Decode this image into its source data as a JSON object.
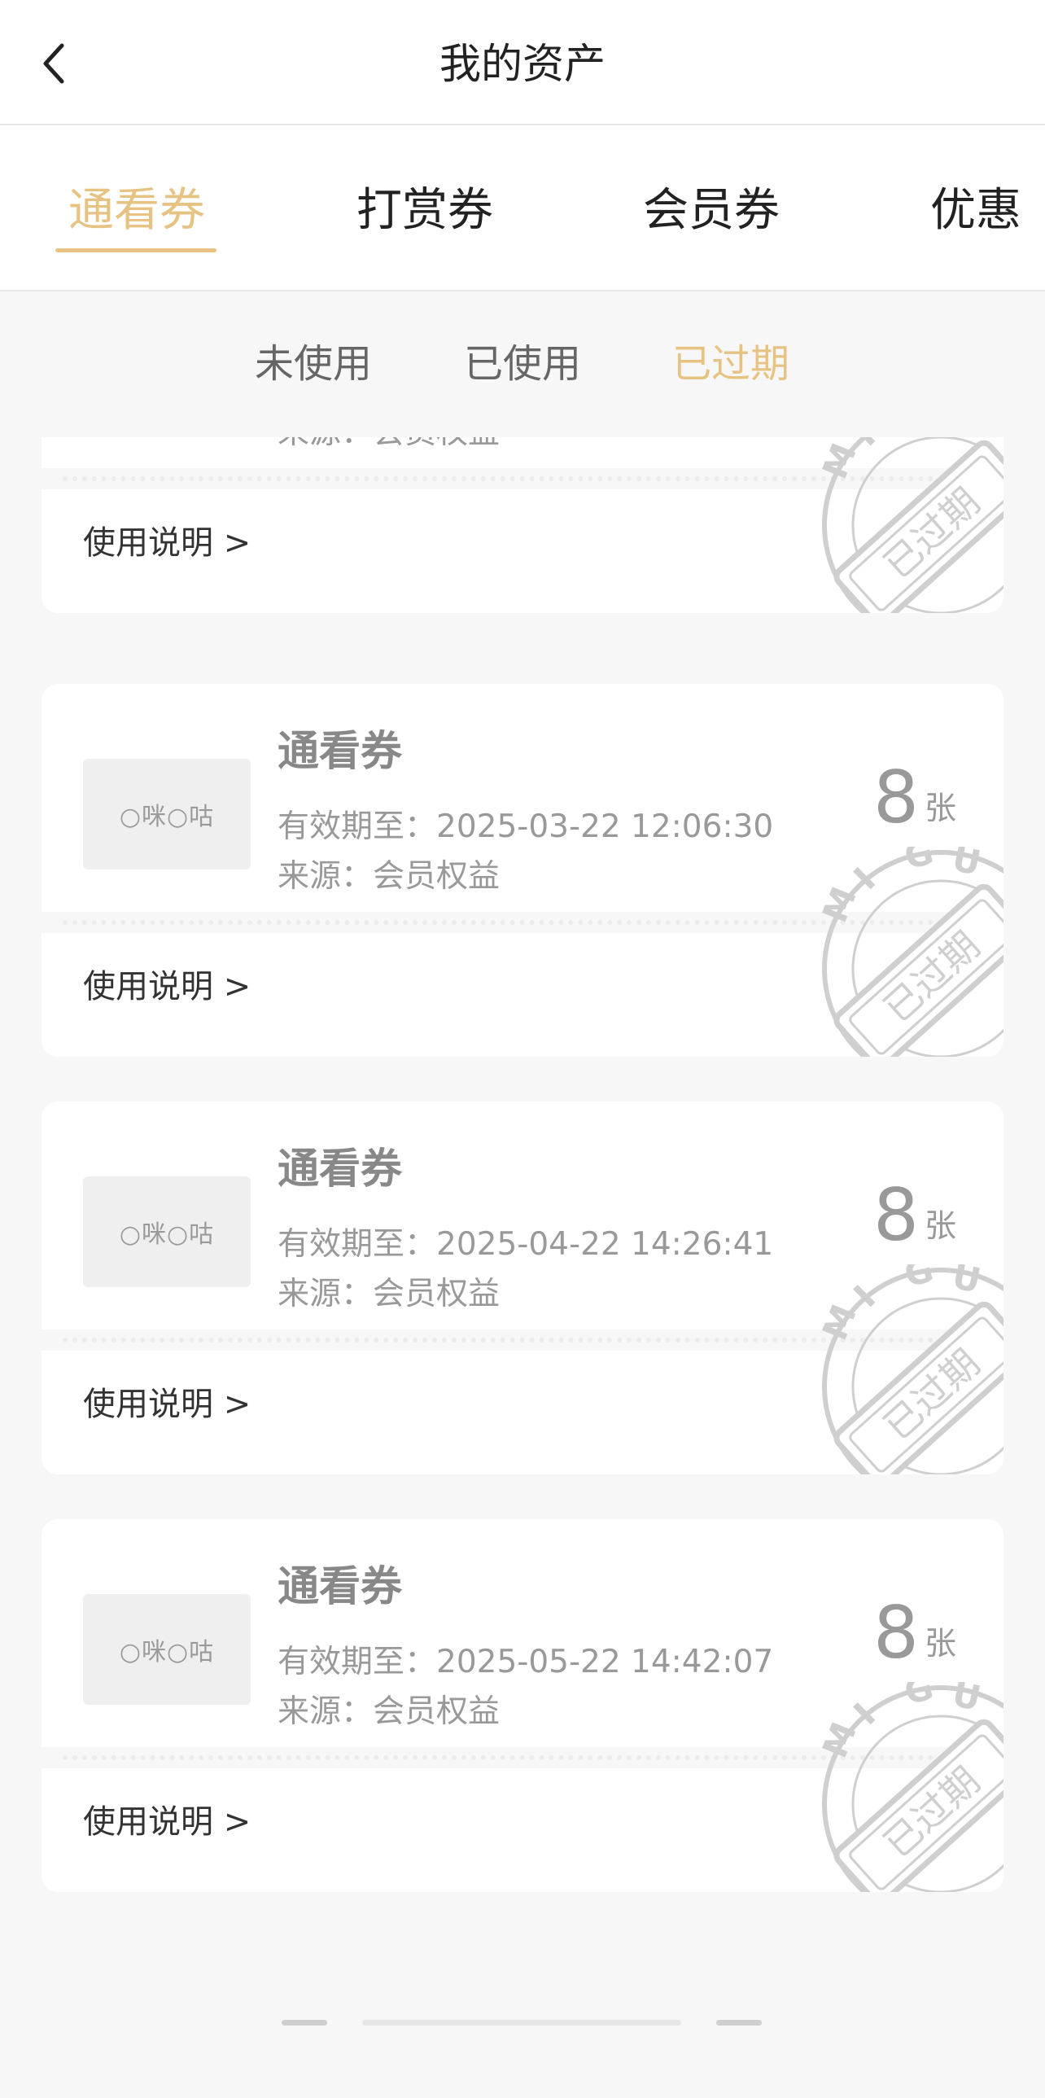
{
  "header": {
    "title": "我的资产",
    "back_icon": "chevron-left-icon"
  },
  "tabs": [
    {
      "label": "通看券",
      "active": true
    },
    {
      "label": "打赏券",
      "active": false
    },
    {
      "label": "会员券",
      "active": false
    },
    {
      "label": "优惠",
      "active": false
    }
  ],
  "subtabs": [
    {
      "label": "未使用",
      "active": false
    },
    {
      "label": "已使用",
      "active": false
    },
    {
      "label": "已过期",
      "active": true
    }
  ],
  "colors": {
    "accent": "#e7c383",
    "background": "#f7f7f7",
    "card": "#ffffff",
    "muted_text": "#999999",
    "stamp": "#cccccc"
  },
  "cards": [
    {
      "title": "",
      "expiry": "",
      "source": "来源：会员权益",
      "count": "",
      "unit": "",
      "instructions": "使用说明 >",
      "thumb_text": "",
      "stamp": {
        "letters": [
          "M",
          "I",
          "G",
          "U"
        ],
        "label": "已过期"
      }
    },
    {
      "title": "通看券",
      "expiry": "有效期至：2025-03-22 12:06:30",
      "source": "来源：会员权益",
      "count": "8",
      "unit": "张",
      "instructions": "使用说明 >",
      "thumb_text": "○咪○咕",
      "stamp": {
        "letters": [
          "M",
          "I",
          "G",
          "U"
        ],
        "label": "已过期"
      }
    },
    {
      "title": "通看券",
      "expiry": "有效期至：2025-04-22 14:26:41",
      "source": "来源：会员权益",
      "count": "8",
      "unit": "张",
      "instructions": "使用说明 >",
      "thumb_text": "○咪○咕",
      "stamp": {
        "letters": [
          "M",
          "I",
          "G",
          "U"
        ],
        "label": "已过期"
      }
    },
    {
      "title": "通看券",
      "expiry": "有效期至：2025-05-22 14:42:07",
      "source": "来源：会员权益",
      "count": "8",
      "unit": "张",
      "instructions": "使用说明 >",
      "thumb_text": "○咪○咕",
      "stamp": {
        "letters": [
          "M",
          "I",
          "G",
          "U"
        ],
        "label": "已过期"
      }
    }
  ]
}
